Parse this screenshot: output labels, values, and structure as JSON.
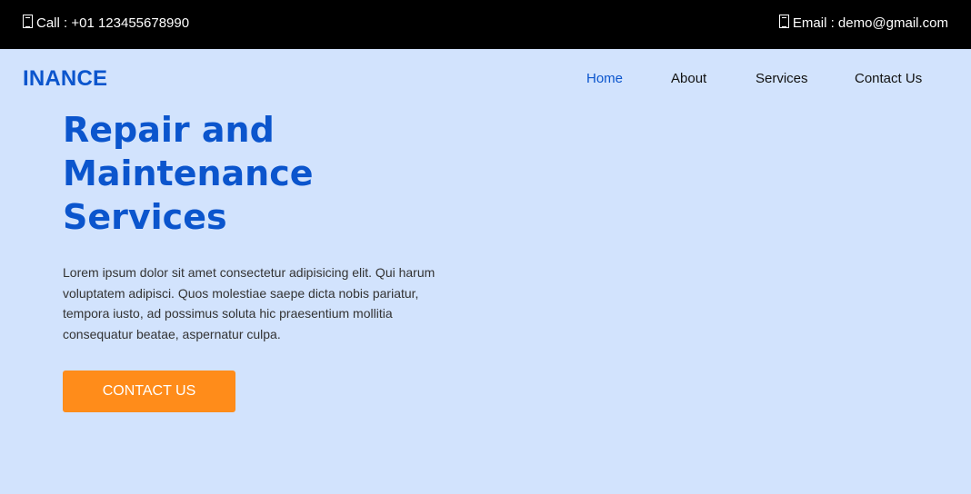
{
  "topbar": {
    "call_text": "Call : +01 123455678990",
    "email_text": "Email : demo@gmail.com",
    "phone_icon": "phone-icon",
    "email_icon": "email-icon"
  },
  "header": {
    "brand": "INANCE",
    "nav": [
      {
        "label": "Home",
        "active": true
      },
      {
        "label": "About",
        "active": false
      },
      {
        "label": "Services",
        "active": false
      },
      {
        "label": "Contact Us",
        "active": false
      }
    ]
  },
  "hero": {
    "title": "Repair and Maintenance Services",
    "text": "Lorem ipsum dolor sit amet consectetur adipisicing elit. Qui harum voluptatem adipisci. Quos molestiae saepe dicta nobis pariatur, tempora iusto, ad possimus soluta hic praesentium mollitia consequatur beatae, aspernatur culpa.",
    "cta_label": "CONTACT US"
  },
  "colors": {
    "accent_blue": "#0b55cd",
    "background": "#d2e3fd",
    "cta_orange": "#ff8c1a",
    "topbar": "#000000"
  }
}
